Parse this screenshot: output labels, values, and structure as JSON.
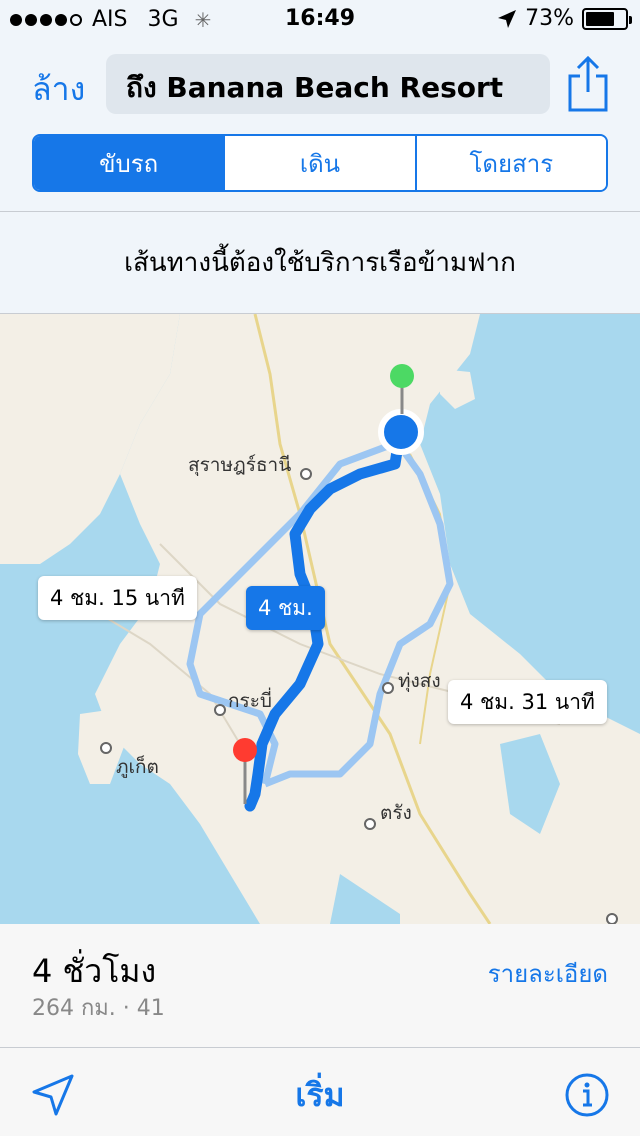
{
  "status_bar": {
    "signal_dots": 5,
    "signal_filled": 4,
    "carrier": "AIS",
    "network": "3G",
    "activity_icon": "loading-spinner",
    "time": "16:49",
    "location_icon": "location-arrow",
    "battery_percent": "73%",
    "battery_level": 0.73
  },
  "header": {
    "clear_label": "ล้าง",
    "destination": "ถึง Banana Beach Resort",
    "share_icon": "share-icon"
  },
  "transport_modes": [
    {
      "label": "ขับรถ",
      "active": true
    },
    {
      "label": "เดิน",
      "active": false
    },
    {
      "label": "โดยสาร",
      "active": false
    }
  ],
  "notice": "เส้นทางนี้ต้องใช้บริการเรือข้ามฟาก",
  "map": {
    "places": [
      {
        "name": "สุราษฎร์ธานี"
      },
      {
        "name": "ทุ่งสง"
      },
      {
        "name": "กระบี่"
      },
      {
        "name": "ภูเก็ต"
      },
      {
        "name": "ตรัง"
      }
    ],
    "route_labels": {
      "primary": "4 ชม.",
      "alt_west": "4 ชม. 15 นาที",
      "alt_east": "4 ชม. 31 นาที"
    },
    "colors": {
      "water": "#a8d8ee",
      "land": "#f3efe6",
      "route_primary": "#1677e8",
      "route_alternate": "#9cc6f2"
    }
  },
  "summary": {
    "duration": "4 ชั่วโมง",
    "distance": "264 กม. · 41",
    "details_label": "รายละเอียด"
  },
  "toolbar": {
    "locate_icon": "location-arrow-icon",
    "start_label": "เริ่ม",
    "info_icon": "info-icon"
  },
  "accent_color": "#1677e8"
}
